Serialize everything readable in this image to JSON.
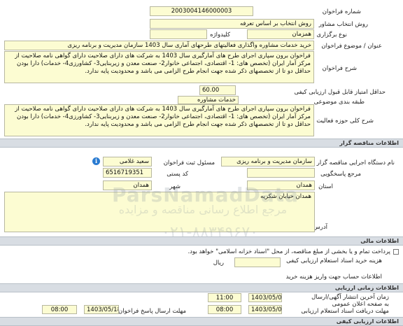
{
  "general": {
    "tender_number_label": "شماره فراخوان",
    "tender_number": "2003004146000003",
    "selection_method_label": "روش انتخاب مشاور",
    "selection_method": "روش انتخاب بر اساس تعرفه",
    "holding_type_label": "نوع برگزاری",
    "holding_type": "همزمان",
    "keyword_label": "کلیدواژه",
    "keyword": "",
    "title_label": "عنوان / موضوع فراخوان",
    "title": "خرید خدمات مشاوره واگذاری فعالیتهای طرحهای آماری سال 1403 سازمان مدیریت و برنامه ریزی",
    "description_label": "شرح فراخوان",
    "description": "فراخوان برون سپاری اجرای طرح های آمارگیری سال 1403 به شرکت های دارای صلاحیت دارای گواهی نامه صلاحیت از مرکز آمار ایران (تخصص های: 1- اقتصادی، اجتماعی خانوار2- صنعت معدن و زیربنایی3- کشاورزی4- خدمات) دارا بودن حداقل دو تا از تخصصهای ذکر شده جهت انجام طرح الزامی می باشد و محدودیت پایه ندارد.",
    "min_score_label": "حداقل امتیاز قابل قبول ارزیابی کیفی",
    "min_score": "60.00",
    "category_label": "طبقه بندی موضوعی",
    "category": "خدمات مشاوره",
    "scope_label": "شرح کلی حوزه فعالیت",
    "scope": "فراخوان برون سپاری اجرای طرح های آمارگیری سال 1403 به شرکت های دارای صلاحیت دارای گواهی نامه صلاحیت از مرکز آمار ایران (تخصص های: 1- اقتصادی، اجتماعی خانوار2- صنعت معدن و زیربنایی3- کشاورزی4- خدمات) دارا بودن حداقل دو تا از تخصصهای ذکر شده جهت انجام طرح الزامی می باشد و محدودیت پایه ندارد."
  },
  "organizer": {
    "section_title": "اطلاعات مناقصه گزار",
    "org_name_label": "نام دستگاه اجرایی مناقصه گزار",
    "org_name": "سازمان مدیریت و برنامه ریزی",
    "registrar_label": "مسئول ثبت فراخوان",
    "registrar": "سعید غلامی",
    "reference_label": "مرجع پاسخگویی",
    "reference": "",
    "postal_code_label": "کد پستی",
    "postal_code": "6516719351",
    "province_label": "استان",
    "province": "همدان",
    "city_label": "شهر",
    "city": "همدان",
    "address_label": "آدرس",
    "address": "همدان خیابان شکریه"
  },
  "financial": {
    "section_title": "اطلاعات مالی",
    "payment_note": "پرداخت تمام و یا بخشی از مبلغ مناقصه، از محل \"اسناد خزانه اسلامی\" خواهد بود.",
    "doc_cost_label": "هزینه خرید اسناد استعلام ارزیابی کیفی",
    "doc_cost": "",
    "currency": "ریال",
    "account_label": "اطلاعات حساب جهت واریز هزینه خرید"
  },
  "timing": {
    "section_title": "اطلاعات زمانی ارزیابی",
    "publish_label": "زمان آخرین انتشار آگهی/ارسال به صفحه اعلان عمومی",
    "publish_date": "1403/05/07",
    "publish_time": "11:00",
    "receive_deadline_label": "مهلت دریافت اسناد استعلام ارزیابی",
    "receive_deadline_date": "1403/05/09",
    "receive_deadline_time": "08:00",
    "submit_deadline_label": "مهلت ارسال پاسخ فراخوان/استعلام",
    "submit_deadline_date": "1403/05/18",
    "submit_deadline_time": "08:00"
  },
  "footer": {
    "section_title": "اطلاعات ارزیابی کیفی"
  },
  "watermark": {
    "line1": "ParsNamadData",
    "line2": "مرجع اطلاع رسانی مناقصه و مزایده",
    "line3": "۰۲۱-۸۸۳۴۹۶۷۰"
  },
  "colors": {
    "field_bg": "#fcfcd2",
    "section_bg": "#d8dde3",
    "info_icon": "#2a7bd1"
  }
}
